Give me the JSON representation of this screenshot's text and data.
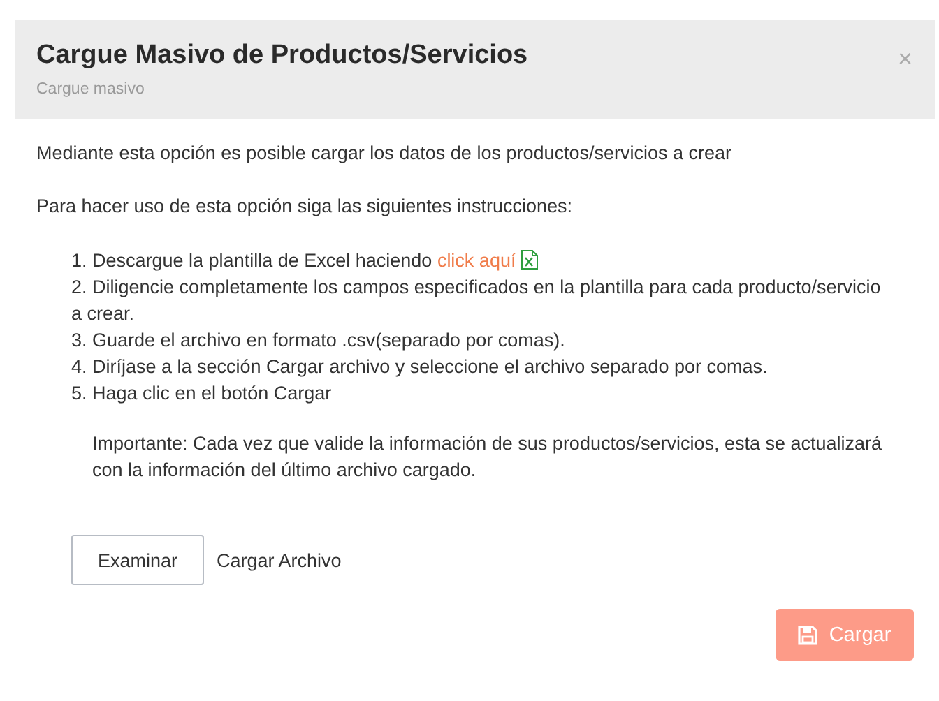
{
  "modal": {
    "title": "Cargue Masivo de Productos/Servicios",
    "subtitle": "Cargue masivo",
    "close": "×"
  },
  "intro": "Mediante esta opción es posible cargar los datos de los productos/servicios a crear",
  "instructions_heading": "Para hacer uso de esta opción siga las siguientes instrucciones:",
  "steps": [
    {
      "text": "1. Descargue la plantilla de Excel haciendo",
      "link": "click aquí"
    },
    {
      "text": "2. Diligencie completamente los campos especificados en la plantilla para cada producto/servicio a crear."
    },
    {
      "text": "3. Guarde el archivo en formato .csv(separado por comas)."
    },
    {
      "text": "4. Diríjase a la sección Cargar archivo y seleccione el archivo separado por comas."
    },
    {
      "text": "5. Haga clic en el botón Cargar"
    }
  ],
  "note": "Importante: Cada vez que valide la información de sus productos/servicios, esta se actualizará con la información del último archivo cargado.",
  "file_input": {
    "button": "Examinar",
    "label": "Cargar Archivo"
  },
  "submit": {
    "label": "Cargar",
    "disabled": true
  }
}
